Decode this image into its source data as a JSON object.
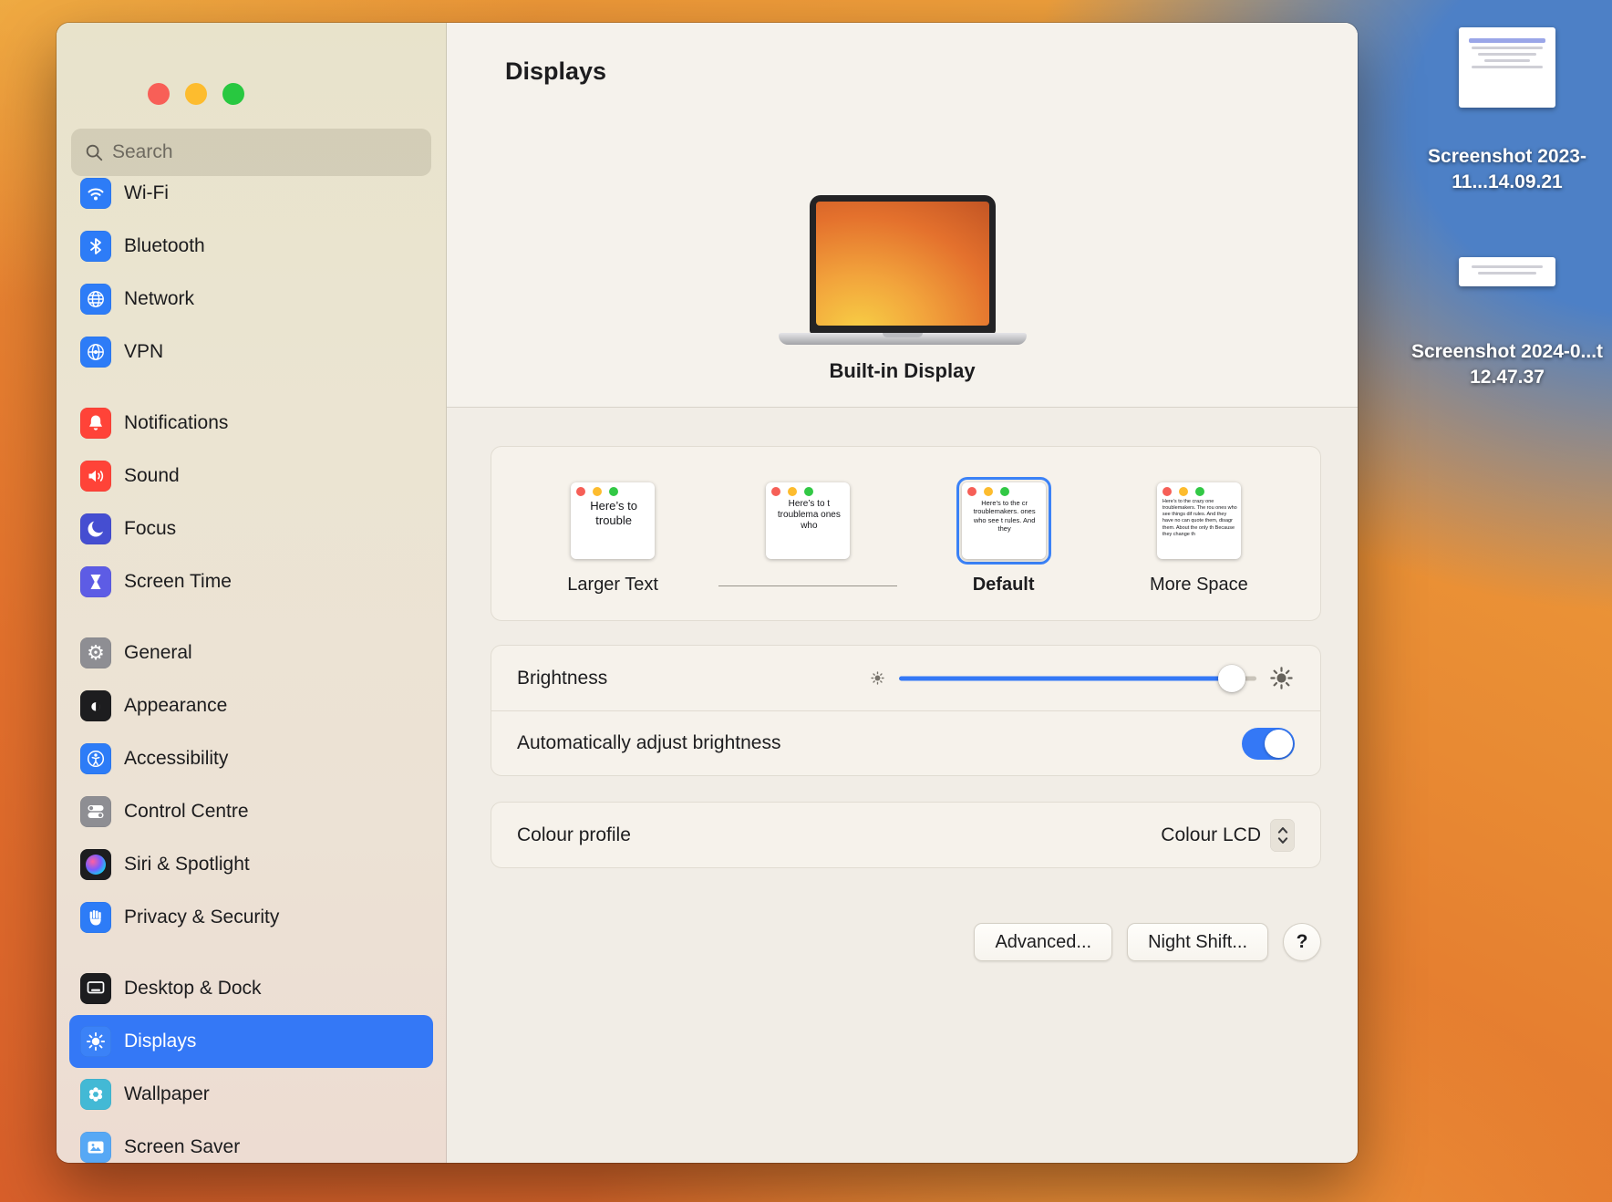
{
  "window": {
    "sidebar": {
      "search": {
        "placeholder": "Search"
      },
      "groups": [
        {
          "items": [
            {
              "label": "Wi-Fi",
              "icon": "wifi-icon",
              "color": "#2d7cf7"
            },
            {
              "label": "Bluetooth",
              "icon": "bluetooth-icon",
              "color": "#2d7cf7"
            },
            {
              "label": "Network",
              "icon": "network-globe-icon",
              "color": "#2d7cf7"
            },
            {
              "label": "VPN",
              "icon": "vpn-globe-icon",
              "color": "#2d7cf7"
            }
          ]
        },
        {
          "items": [
            {
              "label": "Notifications",
              "icon": "bell-icon",
              "color": "#ff4338"
            },
            {
              "label": "Sound",
              "icon": "speaker-icon",
              "color": "#ff4338"
            },
            {
              "label": "Focus",
              "icon": "moon-icon",
              "color": "#454ed1"
            },
            {
              "label": "Screen Time",
              "icon": "hourglass-icon",
              "color": "#5d5ce5"
            }
          ]
        },
        {
          "items": [
            {
              "label": "General",
              "icon": "gear-icon",
              "color": "#8e8e93"
            },
            {
              "label": "Appearance",
              "icon": "half-circle-icon",
              "color": "#1d1d1f"
            },
            {
              "label": "Accessibility",
              "icon": "accessibility-person-icon",
              "color": "#2d7cf7"
            },
            {
              "label": "Control Centre",
              "icon": "toggles-icon",
              "color": "#8e8e93"
            },
            {
              "label": "Siri & Spotlight",
              "icon": "siri-orb-icon",
              "color": "#1d1d1f"
            },
            {
              "label": "Privacy & Security",
              "icon": "hand-icon",
              "color": "#2d7cf7"
            }
          ]
        },
        {
          "items": [
            {
              "label": "Desktop & Dock",
              "icon": "desktop-dock-icon",
              "color": "#1d1d1f"
            },
            {
              "label": "Displays",
              "icon": "sun-display-icon",
              "color": "#3b82f7",
              "selected": true
            },
            {
              "label": "Wallpaper",
              "icon": "flower-icon",
              "color": "#43b9d5"
            },
            {
              "label": "Screen Saver",
              "icon": "photo-icon",
              "color": "#57a8f5"
            }
          ]
        }
      ]
    },
    "content": {
      "title": "Displays",
      "display": {
        "name": "Built-in Display"
      },
      "resolution": {
        "options": [
          {
            "label": "Larger Text",
            "preview": "Here’s to trouble",
            "selected": false
          },
          {
            "label": "",
            "preview": "Here’s to t troublema ones who",
            "selected": false
          },
          {
            "label": "Default",
            "preview": "Here’s to the cr troublemakers. ones who see t rules. And they",
            "selected": true
          },
          {
            "label": "More Space",
            "preview": "Here’s to the crazy one troublemakers. The rou ones who see things dif rules. And they have no can quote them, disagr them. About the only th Because they change th",
            "selected": false
          }
        ]
      },
      "brightness": {
        "label": "Brightness",
        "value_percent": 93
      },
      "auto_brightness": {
        "label": "Automatically adjust brightness",
        "enabled": true
      },
      "colour_profile": {
        "label": "Colour profile",
        "value": "Colour LCD"
      },
      "buttons": {
        "advanced": "Advanced...",
        "night_shift": "Night Shift...",
        "help": "?"
      }
    }
  },
  "desktop": {
    "icons": [
      {
        "label": "Screenshot 2023-11...14.09.21"
      },
      {
        "label": "Screenshot 2024-0...t 12.47.37"
      }
    ]
  },
  "colors": {
    "accent": "#3478f6",
    "selection": "#3478f6",
    "toggle_on": "#3478f6"
  }
}
